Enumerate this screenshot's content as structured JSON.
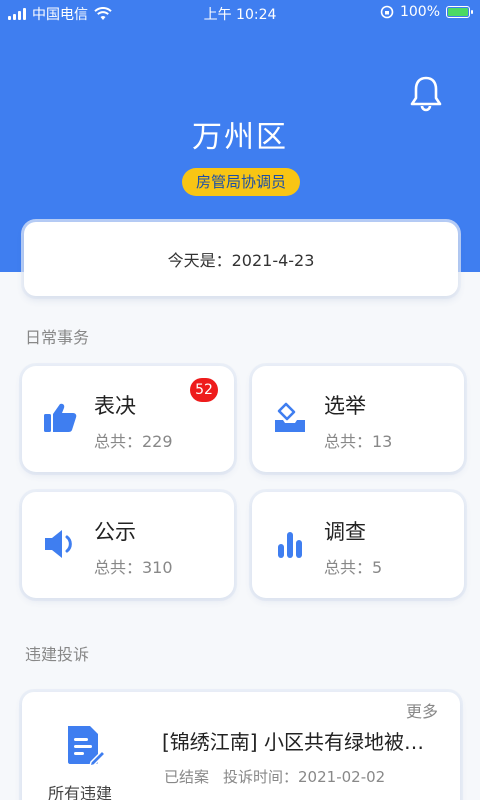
{
  "status_bar": {
    "carrier": "中国电信",
    "time": "上午 10:24",
    "battery": "100%",
    "battery_level": 1.0
  },
  "header": {
    "region": "万州区",
    "role": "房管局协调员"
  },
  "date_card": {
    "text": "今天是：2021-4-23"
  },
  "daily_affairs": {
    "label": "日常事务",
    "tiles": [
      {
        "title": "表决",
        "count": "总共：229",
        "badge": "52",
        "icon": "thumbs-up-icon"
      },
      {
        "title": "选举",
        "count": "总共：13",
        "icon": "ballot-box-icon"
      },
      {
        "title": "公示",
        "count": "总共：310",
        "icon": "speaker-icon"
      },
      {
        "title": "调查",
        "count": "总共：5",
        "icon": "bar-chart-icon"
      }
    ]
  },
  "complaints": {
    "label": "违建投诉",
    "more": "更多",
    "all_label": "所有违建",
    "all_icon": "document-edit-icon",
    "item": {
      "title": "[锦绣江南] 小区共有绿地被侵占",
      "status": "已结案",
      "time": "投诉时间：2021-02-02"
    }
  },
  "colors": {
    "primary": "#3f7ef0",
    "badge_yellow": "#f8c514",
    "alert_red": "#ee1c1c",
    "battery_green": "#4cd964"
  }
}
